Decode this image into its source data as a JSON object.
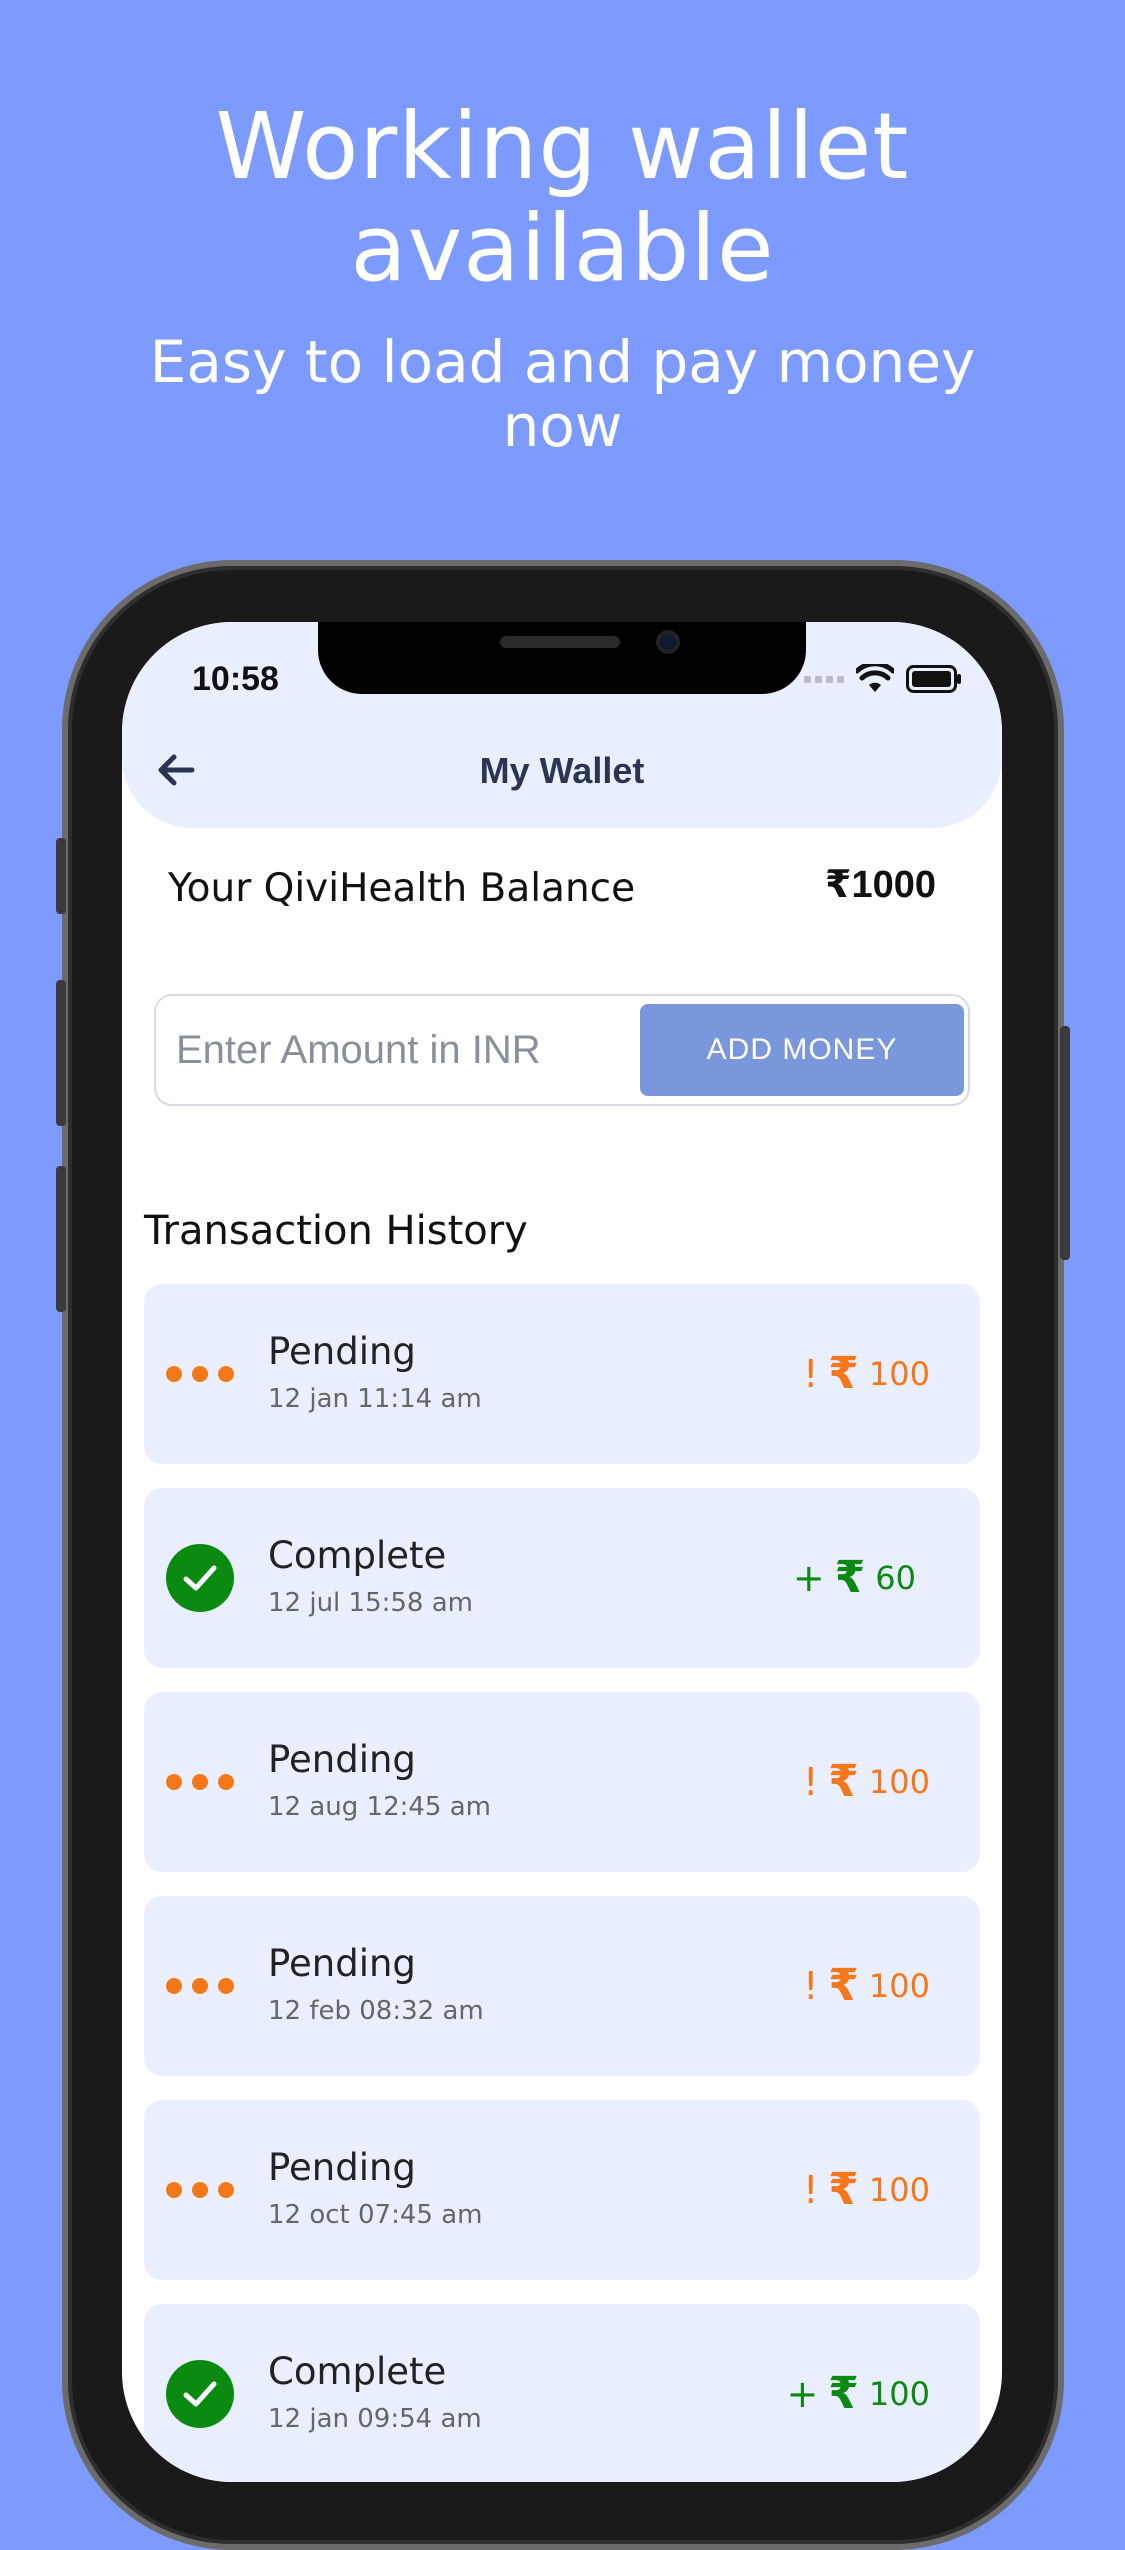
{
  "promo": {
    "headline": "Working wallet available",
    "subline": "Easy to load and pay money now"
  },
  "status_bar": {
    "time": "10:58"
  },
  "header": {
    "title": "My Wallet"
  },
  "balance": {
    "label": "Your QiviHealth Balance",
    "value": "₹1000"
  },
  "add_money": {
    "placeholder": "Enter Amount in INR",
    "button_label": "ADD MONEY"
  },
  "history": {
    "title": "Transaction History",
    "currency_symbol": "₹",
    "transactions": [
      {
        "status": "Pending",
        "date": "12 jan 11:14 am",
        "sign": "!",
        "amount": "100",
        "kind": "pending"
      },
      {
        "status": "Complete",
        "date": "12 jul 15:58 am",
        "sign": "+",
        "amount": "60",
        "kind": "complete"
      },
      {
        "status": "Pending",
        "date": "12 aug 12:45 am",
        "sign": "!",
        "amount": "100",
        "kind": "pending"
      },
      {
        "status": "Pending",
        "date": "12 feb 08:32 am",
        "sign": "!",
        "amount": "100",
        "kind": "pending"
      },
      {
        "status": "Pending",
        "date": "12 oct 07:45 am",
        "sign": "!",
        "amount": "100",
        "kind": "pending"
      },
      {
        "status": "Complete",
        "date": "12 jan 09:54 am",
        "sign": "+",
        "amount": "100",
        "kind": "complete"
      }
    ]
  },
  "colors": {
    "background": "#7d9bff",
    "header_bg": "#e9efff",
    "card_bg": "#eaefff",
    "pending": "#f47718",
    "complete": "#0a8a10",
    "button": "#7b97dc"
  }
}
